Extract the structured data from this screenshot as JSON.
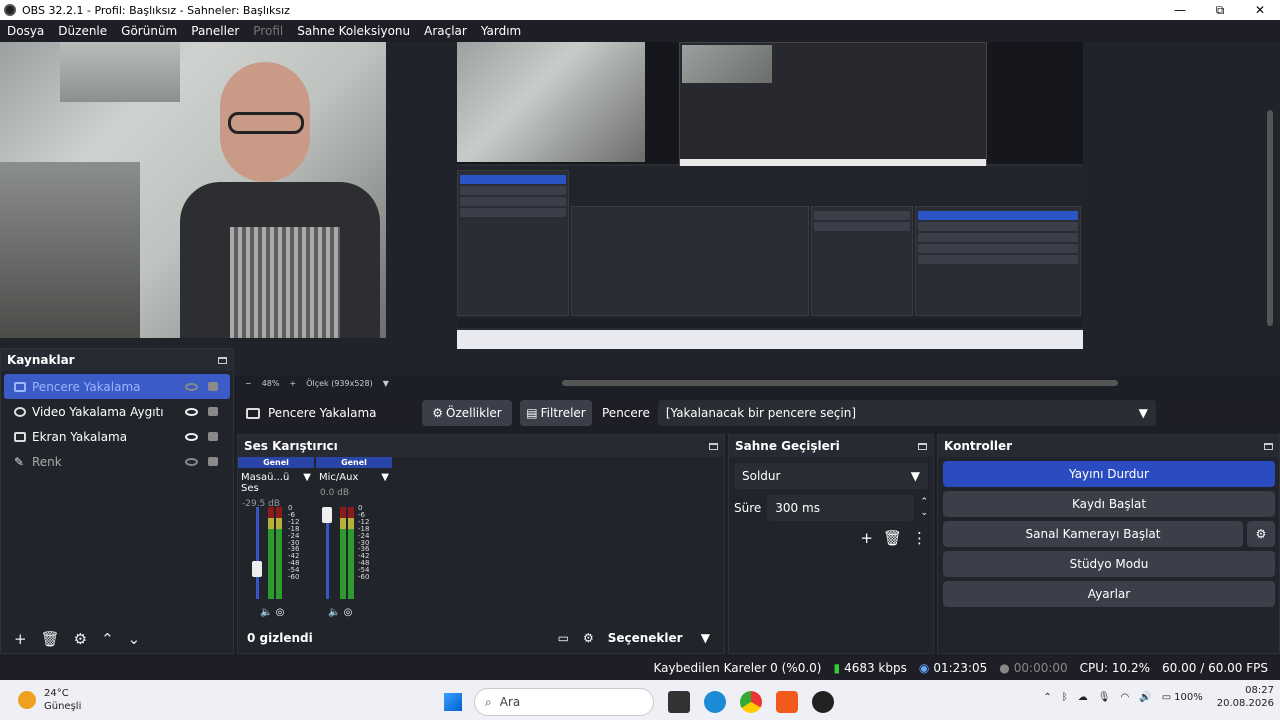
{
  "window": {
    "title": "OBS 32.2.1 - Profil: Başlıksız - Sahneler: Başlıksız",
    "minimize": "—",
    "maximize": "⧉",
    "close": "✕"
  },
  "menu": {
    "items": [
      "Dosya",
      "Düzenle",
      "Görünüm",
      "Paneller",
      "Profil",
      "Sahne Koleksiyonu",
      "Araçlar",
      "Yardım"
    ]
  },
  "preview": {
    "zoom": "48%",
    "scale_label": "Ölçek (939x528)",
    "zoom_out": "−",
    "zoom_in": "+"
  },
  "source_bar": {
    "source_name": "Pencere Yakalama",
    "properties": "Özellikler",
    "filters": "Filtreler",
    "window_label": "Pencere",
    "window_value": "[Yakalanacak bir pencere seçin]"
  },
  "sources": {
    "title": "Kaynaklar",
    "items": [
      {
        "name": "Pencere Yakalama",
        "selected": true,
        "visible": false
      },
      {
        "name": "Video Yakalama Aygıtı",
        "selected": false,
        "visible": true
      },
      {
        "name": "Ekran Yakalama",
        "selected": false,
        "visible": true
      },
      {
        "name": "Renk",
        "selected": false,
        "visible": false
      }
    ]
  },
  "mixer": {
    "title": "Ses Karıştırıcı",
    "channels": [
      {
        "tag": "Genel",
        "name": "Masaü...ü Ses",
        "db": "-29.5 dB",
        "level": 0.33
      },
      {
        "tag": "Genel",
        "name": "Mic/Aux",
        "db": "0.0 dB",
        "level": 1.0
      }
    ],
    "scale": [
      "0",
      "-6",
      "-12",
      "-18",
      "-24",
      "-30",
      "-36",
      "-42",
      "-48",
      "-54",
      "-60"
    ],
    "hidden_count": "0 gizlendi",
    "options": "Seçenekler"
  },
  "transitions": {
    "title": "Sahne Geçişleri",
    "selected": "Soldur",
    "duration_label": "Süre",
    "duration_value": "300 ms"
  },
  "controls": {
    "title": "Kontroller",
    "stop_stream": "Yayını Durdur",
    "start_recording": "Kaydı Başlat",
    "start_virtualcam": "Sanal Kamerayı Başlat",
    "studio_mode": "Stüdyo Modu",
    "settings": "Ayarlar"
  },
  "status": {
    "dropped_frames": "Kaybedilen Kareler 0 (%0.0)",
    "bitrate": "4683 kbps",
    "stream_time": "01:23:05",
    "rec_time": "00:00:00",
    "cpu": "CPU: 10.2%",
    "fps": "60.00 / 60.00 FPS"
  },
  "taskbar": {
    "temp": "24°C",
    "weather": "Güneşli",
    "search": "Ara",
    "battery": "100%",
    "time": "08:27",
    "date": "20.08.2026"
  },
  "colors": {
    "accent": "#2b4bc0",
    "panel": "#22242c",
    "bg": "#1d1f26"
  }
}
